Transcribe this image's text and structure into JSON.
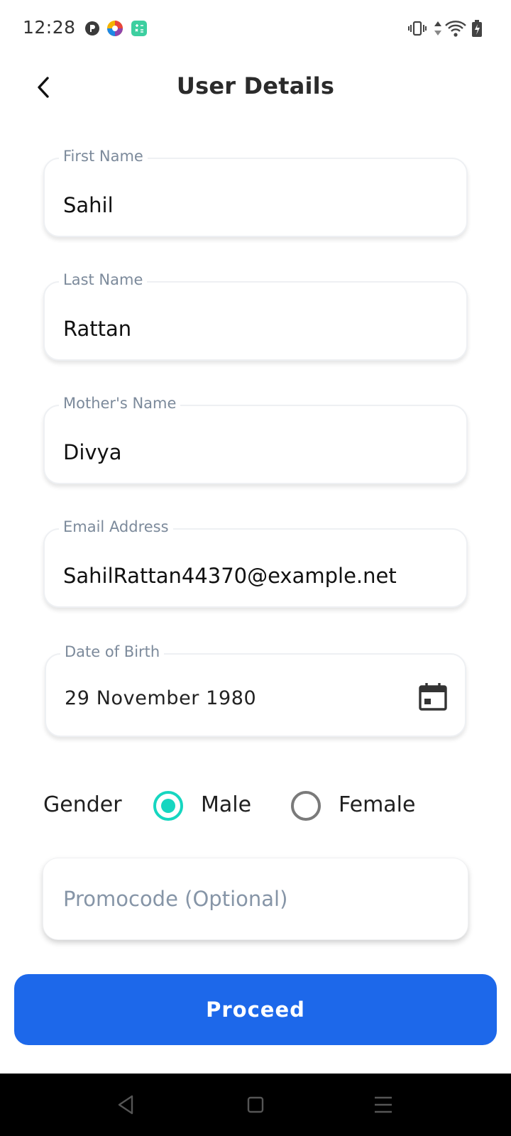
{
  "status_bar": {
    "time": "12:28",
    "notification_icons": [
      "game-app-icon",
      "photos-app-icon",
      "calculator-app-icon"
    ],
    "system_icons": [
      "vibrate-icon",
      "data-arrows-icon",
      "wifi-icon",
      "battery-charging-icon"
    ]
  },
  "header": {
    "title": "User Details",
    "back_icon": "chevron-left-icon"
  },
  "form": {
    "first_name": {
      "label": "First Name",
      "value": "Sahil"
    },
    "last_name": {
      "label": "Last Name",
      "value": "Rattan"
    },
    "mothers_name": {
      "label": "Mother's Name",
      "value": "Divya"
    },
    "email": {
      "label": "Email Address",
      "value": "SahilRattan44370@example.net"
    },
    "dob": {
      "label": "Date of Birth",
      "value": "29 November 1980",
      "icon": "calendar-icon"
    },
    "gender": {
      "label": "Gender",
      "options": [
        {
          "label": "Male",
          "selected": true
        },
        {
          "label": "Female",
          "selected": false
        }
      ]
    },
    "promocode": {
      "placeholder": "Promocode (Optional)",
      "value": ""
    }
  },
  "actions": {
    "proceed_label": "Proceed"
  },
  "nav_bar": {
    "buttons": [
      "nav-back-icon",
      "nav-home-icon",
      "nav-menu-icon"
    ]
  },
  "colors": {
    "accent": "#1d68ea",
    "radio_selected": "#16d6c0",
    "label_gray": "#7c8a9b",
    "placeholder": "#8695a7"
  }
}
